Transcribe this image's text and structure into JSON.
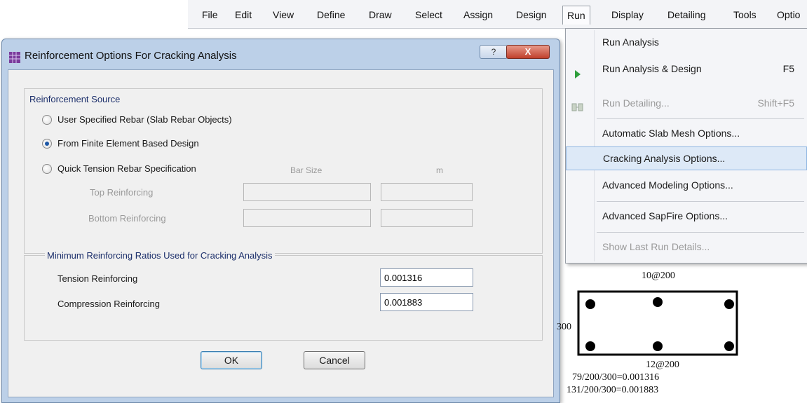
{
  "menubar": {
    "items": [
      "File",
      "Edit",
      "View",
      "Define",
      "Draw",
      "Select",
      "Assign",
      "Design",
      "Run",
      "Display",
      "Detailing",
      "Tools",
      "Optio"
    ],
    "active": "Run"
  },
  "run_menu": {
    "items": [
      {
        "label": "Run Analysis",
        "shortcut": "",
        "icon": "",
        "state": "normal"
      },
      {
        "label": "Run Analysis & Design",
        "shortcut": "F5",
        "icon": "play-icon",
        "state": "normal"
      },
      {
        "label": "Run Detailing...",
        "shortcut": "Shift+F5",
        "icon": "detailing-icon",
        "state": "disabled"
      },
      {
        "label": "Automatic Slab Mesh Options...",
        "shortcut": "",
        "icon": "",
        "state": "normal"
      },
      {
        "label": "Cracking Analysis Options...",
        "shortcut": "",
        "icon": "",
        "state": "highlighted"
      },
      {
        "label": "Advanced Modeling Options...",
        "shortcut": "",
        "icon": "",
        "state": "normal"
      },
      {
        "label": "Advanced SapFire Options...",
        "shortcut": "",
        "icon": "",
        "state": "normal"
      },
      {
        "label": "Show Last Run Details...",
        "shortcut": "",
        "icon": "",
        "state": "disabled"
      }
    ]
  },
  "dialog": {
    "title": "Reinforcement Options For Cracking Analysis",
    "help_label": "?",
    "close_label": "X",
    "source_group": {
      "title": "Reinforcement Source",
      "options": [
        {
          "label": "User Specified Rebar  (Slab Rebar Objects)",
          "checked": false
        },
        {
          "label": "From Finite Element Based Design",
          "checked": true
        },
        {
          "label": "Quick Tension Rebar Specification",
          "checked": false
        }
      ],
      "bar_size_header": "Bar Size",
      "spacing_header": "m",
      "top_label": "Top Reinforcing",
      "bottom_label": "Bottom Reinforcing"
    },
    "ratio_group": {
      "title": "Minimum Reinforcing Ratios Used for Cracking Analysis",
      "tension_label": "Tension Reinforcing",
      "tension_value": "0.001316",
      "compression_label": "Compression Reinforcing",
      "compression_value": "0.001883"
    },
    "ok_label": "OK",
    "cancel_label": "Cancel"
  },
  "sketch": {
    "top_bars": "10@200",
    "depth": "300",
    "bottom_bars": "12@200",
    "calc_1": "79/200/300=0.001316",
    "calc_2": "131/200/300=0.001883"
  },
  "colors": {
    "dialog_frame": "#bcd0e8",
    "close_button": "#c0402c",
    "menu_highlight": "#dde9f7",
    "group_title": "#1c2f6b"
  }
}
